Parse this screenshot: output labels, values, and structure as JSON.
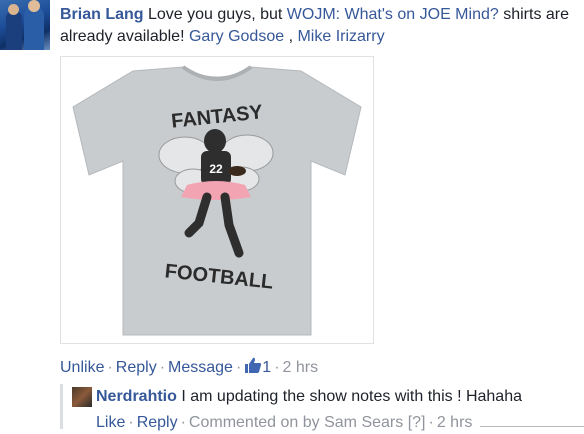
{
  "comment": {
    "author": "Brian Lang",
    "text_before": " Love you guys, but ",
    "link": "WOJM: What's on JOE Mind?",
    "text_after": " shirts are already available! ",
    "tag1": "Gary Godsoe",
    "tag_sep": " , ",
    "tag2": "Mike Irizarry",
    "image": {
      "shirt_top_text": "FANTASY",
      "shirt_bottom_text": "FOOTBALL",
      "jersey_number": "22"
    },
    "actions": {
      "unlike": "Unlike",
      "reply": "Reply",
      "message": "Message",
      "like_count": "1",
      "time": "2 hrs"
    }
  },
  "reply": {
    "author": "Nerdrahtio",
    "text": " I am updating the show notes with this ! Hahaha",
    "actions": {
      "like": "Like",
      "reply": "Reply",
      "commented_on_by": "Commented on by Sam Sears",
      "ref": "[?]",
      "time": "2 hrs"
    }
  },
  "colors": {
    "link": "#365899",
    "meta": "#90949c",
    "text": "#1d2129",
    "shirt": "#c9cccf"
  }
}
